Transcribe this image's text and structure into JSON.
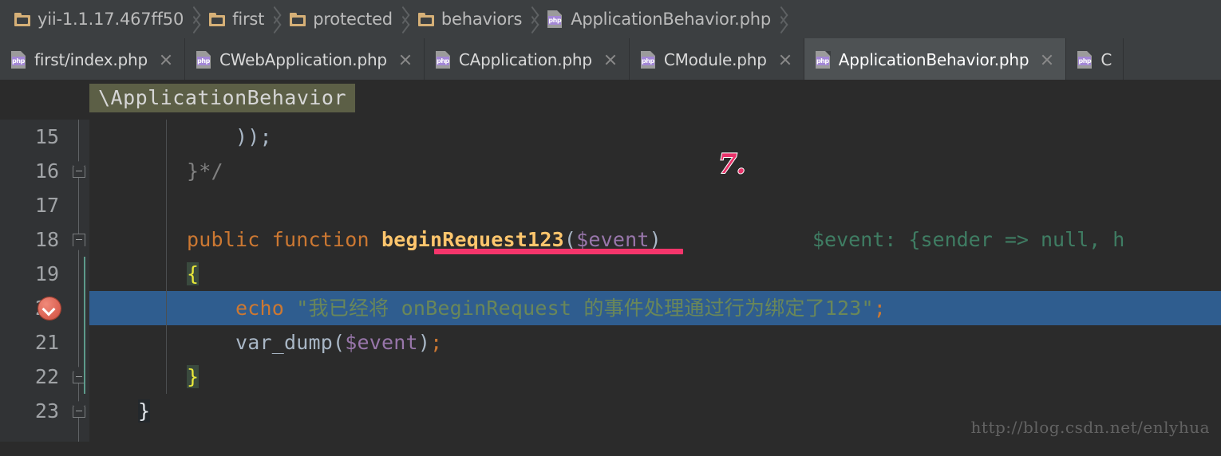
{
  "breadcrumb": {
    "items": [
      {
        "icon": "folder-icon",
        "label": "yii-1.1.17.467ff50"
      },
      {
        "icon": "folder-icon",
        "label": "first"
      },
      {
        "icon": "folder-icon",
        "label": "protected"
      },
      {
        "icon": "folder-icon",
        "label": "behaviors"
      },
      {
        "icon": "php-file-icon",
        "label": "ApplicationBehavior.php"
      }
    ]
  },
  "tabs": [
    {
      "label": "first/index.php",
      "icon": "php-file-icon",
      "active": false
    },
    {
      "label": "CWebApplication.php",
      "icon": "php-file-icon",
      "active": false
    },
    {
      "label": "CApplication.php",
      "icon": "php-file-icon",
      "active": false
    },
    {
      "label": "CModule.php",
      "icon": "php-file-icon",
      "active": false
    },
    {
      "label": "ApplicationBehavior.php",
      "icon": "php-file-icon",
      "active": true
    },
    {
      "label": "C",
      "icon": "php-file-icon",
      "active": false
    }
  ],
  "sticky_header": {
    "label": "\\ApplicationBehavior"
  },
  "editor": {
    "php_badge_text": "php",
    "line_numbers": [
      "15",
      "16",
      "17",
      "18",
      "19",
      "20",
      "21",
      "22",
      "23"
    ],
    "lines": [
      {
        "num": "15",
        "segments": [
          {
            "text": "            ));",
            "cls": "t-plain"
          }
        ]
      },
      {
        "num": "16",
        "segments": [
          {
            "text": "        }*/",
            "cls": "t-comment"
          }
        ]
      },
      {
        "num": "17",
        "segments": [
          {
            "text": "",
            "cls": "t-plain"
          }
        ]
      },
      {
        "num": "18",
        "segments": [
          {
            "text": "        ",
            "cls": "t-plain"
          },
          {
            "text": "public function ",
            "cls": "t-key"
          },
          {
            "text": "beginRequest123",
            "cls": "t-fn"
          },
          {
            "text": "(",
            "cls": "t-punc"
          },
          {
            "text": "$event",
            "cls": "t-var"
          },
          {
            "text": ")",
            "cls": "t-punc"
          }
        ]
      },
      {
        "num": "19",
        "segments": [
          {
            "text": "        ",
            "cls": "t-plain"
          },
          {
            "text": "{",
            "cls": "t-brace-y"
          }
        ]
      },
      {
        "num": "20",
        "segments": [
          {
            "text": "            ",
            "cls": "t-plain"
          },
          {
            "text": "echo",
            "cls": "t-echo"
          },
          {
            "text": " ",
            "cls": "t-plain"
          },
          {
            "text": "\"我已经将 onBeginRequest 的事件处理通过行为绑定了123\"",
            "cls": "t-str"
          },
          {
            "text": ";",
            "cls": "t-semi"
          }
        ]
      },
      {
        "num": "21",
        "segments": [
          {
            "text": "            ",
            "cls": "t-plain"
          },
          {
            "text": "var_dump",
            "cls": "t-plain"
          },
          {
            "text": "(",
            "cls": "t-punc"
          },
          {
            "text": "$event",
            "cls": "t-var"
          },
          {
            "text": ")",
            "cls": "t-punc"
          },
          {
            "text": ";",
            "cls": "t-semi"
          }
        ]
      },
      {
        "num": "22",
        "segments": [
          {
            "text": "        ",
            "cls": "t-plain"
          },
          {
            "text": "}",
            "cls": "t-brace-y"
          }
        ]
      },
      {
        "num": "23",
        "segments": [
          {
            "text": "    ",
            "cls": "t-plain"
          },
          {
            "text": "}",
            "cls": "t-brace-w"
          }
        ]
      }
    ],
    "inline_hint": {
      "line": "18",
      "text": "$event: {sender => null, h",
      "color": "#3f7d63"
    },
    "breakpoint": {
      "line": "20",
      "icon": "breakpoint-verified-icon"
    },
    "highlighted_line": "20",
    "fold_markers": [
      "16",
      "18",
      "22",
      "23"
    ]
  },
  "annotations": {
    "step_number": "7.",
    "step_number_color": "#e8336a",
    "underline_color": "#f5356b"
  },
  "watermark": {
    "text": "http://blog.csdn.net/enlyhua"
  },
  "colors": {
    "editor_bg": "#2b2b2b",
    "gutter_bg": "#313335",
    "chrome_bg": "#3c3f41",
    "active_tab_bg": "#4e5254",
    "selection_bg": "#2f5d8f",
    "keyword": "#cc7832",
    "function": "#ffc66d",
    "variable": "#9876aa",
    "string": "#6a8759",
    "comment": "#808080",
    "sticky_chip_bg": "#5c5f46"
  }
}
